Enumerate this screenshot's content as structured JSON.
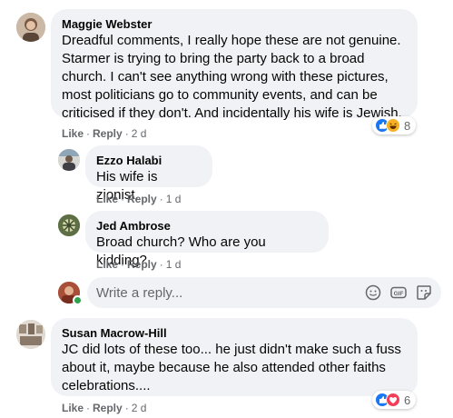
{
  "comments": [
    {
      "author": "Maggie Webster",
      "text": "Dreadful comments, I really hope these are not genuine. Starmer is trying to bring the party back to a broad church. I can't see anything wrong with these pictures, most politicians go to community events, and can be criticised if they don't. And incidentally his wife is Jewish.",
      "like": "Like",
      "reply": "Reply",
      "time": "2 d",
      "reaction_count": "8"
    },
    {
      "author": "Ezzo Halabi",
      "text": "His wife is zionist.",
      "like": "Like",
      "reply": "Reply",
      "time": "1 d"
    },
    {
      "author": "Jed Ambrose",
      "text": "Broad church? Who are you kidding?",
      "like": "Like",
      "reply": "Reply",
      "time": "1 d"
    },
    {
      "author": "Susan Macrow-Hill",
      "text": "JC did lots of these too... he just didn't make such a fuss about it, maybe because he also attended other faiths celebrations....",
      "like": "Like",
      "reply": "Reply",
      "time": "2 d",
      "reaction_count": "6"
    }
  ],
  "reply_box": {
    "placeholder": "Write a reply..."
  },
  "icons": [
    "emoji-icon",
    "gif-icon",
    "sticker-icon",
    "like-reaction-icon",
    "haha-reaction-icon",
    "love-reaction-icon"
  ],
  "colors": {
    "bubble": "#f0f2f5",
    "meta": "#65676b",
    "like_blue": "#1877f2",
    "haha_yellow": "#f7b125",
    "love_red": "#f33e58",
    "online_green": "#31a24c"
  }
}
